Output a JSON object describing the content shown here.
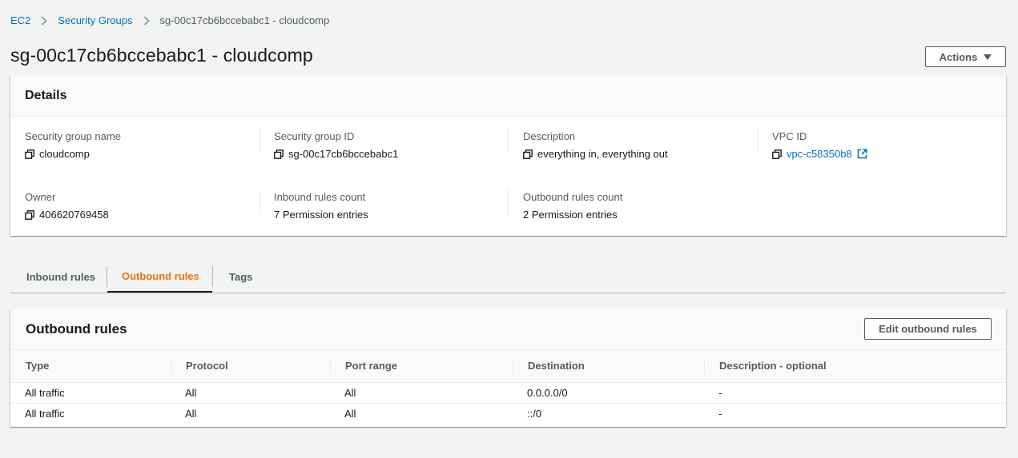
{
  "breadcrumb": {
    "items": [
      "EC2",
      "Security Groups"
    ],
    "current": "sg-00c17cb6bccebabc1 - cloudcomp"
  },
  "page_title": "sg-00c17cb6bccebabc1 - cloudcomp",
  "actions_label": "Actions",
  "details": {
    "title": "Details",
    "fields": {
      "sg_name": {
        "label": "Security group name",
        "value": "cloudcomp"
      },
      "sg_id": {
        "label": "Security group ID",
        "value": "sg-00c17cb6bccebabc1"
      },
      "description": {
        "label": "Description",
        "value": "everything in, everything out"
      },
      "vpc_id": {
        "label": "VPC ID",
        "value": "vpc-c58350b8"
      },
      "owner": {
        "label": "Owner",
        "value": "406620769458"
      },
      "inbound_count": {
        "label": "Inbound rules count",
        "value": "7 Permission entries"
      },
      "outbound_count": {
        "label": "Outbound rules count",
        "value": "2 Permission entries"
      }
    }
  },
  "tabs": [
    "Inbound rules",
    "Outbound rules",
    "Tags"
  ],
  "outbound": {
    "title": "Outbound rules",
    "edit_label": "Edit outbound rules",
    "columns": [
      "Type",
      "Protocol",
      "Port range",
      "Destination",
      "Description - optional"
    ],
    "rows": [
      [
        "All traffic",
        "All",
        "All",
        "0.0.0.0/0",
        "-"
      ],
      [
        "All traffic",
        "All",
        "All",
        "::/0",
        "-"
      ]
    ]
  },
  "colors": {
    "link": "#0073bb",
    "active_tab": "#ec7211",
    "text": "#16191f",
    "muted": "#545b64"
  }
}
